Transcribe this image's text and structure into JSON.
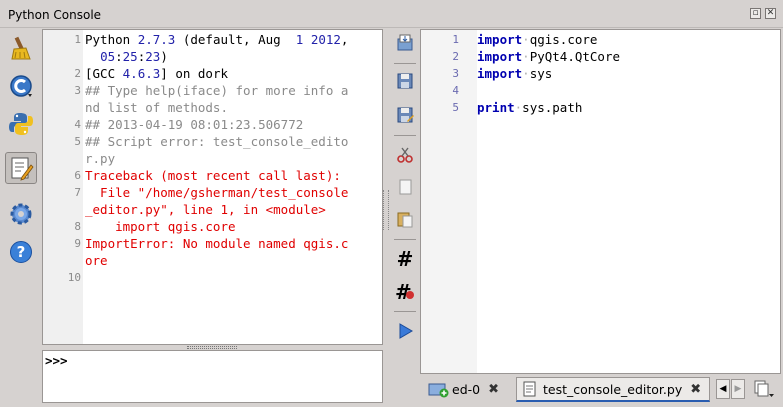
{
  "window": {
    "title": "Python Console",
    "float_symbol": "▫",
    "close_symbol": "✕"
  },
  "console": {
    "lines": [
      {
        "n": "1",
        "parts": [
          {
            "t": "Python ",
            "c": ""
          },
          {
            "t": "2.7.3",
            "c": "blue"
          },
          {
            "t": " (default, Aug  ",
            "c": ""
          },
          {
            "t": "1",
            "c": "blue"
          },
          {
            "t": " ",
            "c": ""
          },
          {
            "t": "2012",
            "c": "blue"
          },
          {
            "t": ",",
            "c": ""
          }
        ]
      },
      {
        "n": "",
        "parts": [
          {
            "t": "  ",
            "c": ""
          },
          {
            "t": "05",
            "c": "blue"
          },
          {
            "t": ":",
            "c": ""
          },
          {
            "t": "25",
            "c": "blue"
          },
          {
            "t": ":",
            "c": ""
          },
          {
            "t": "23",
            "c": "blue"
          },
          {
            "t": ")",
            "c": ""
          }
        ]
      },
      {
        "n": "2",
        "parts": [
          {
            "t": "[GCC ",
            "c": ""
          },
          {
            "t": "4.6.3",
            "c": "blue"
          },
          {
            "t": "] on dork",
            "c": ""
          }
        ]
      },
      {
        "n": "3",
        "parts": [
          {
            "t": "## Type help(iface) for more info a",
            "c": "grey"
          }
        ]
      },
      {
        "n": "",
        "parts": [
          {
            "t": "nd list of methods.",
            "c": "grey"
          }
        ]
      },
      {
        "n": "4",
        "parts": [
          {
            "t": "## 2013-04-19 08:01:23.506772",
            "c": "grey"
          }
        ]
      },
      {
        "n": "5",
        "parts": [
          {
            "t": "## Script error: test_console_edito",
            "c": "grey"
          }
        ]
      },
      {
        "n": "",
        "parts": [
          {
            "t": "r.py",
            "c": "grey"
          }
        ]
      },
      {
        "n": "6",
        "parts": [
          {
            "t": "Traceback (most recent call last):",
            "c": "red"
          }
        ]
      },
      {
        "n": "7",
        "parts": [
          {
            "t": "  File \"/home/gsherman/test_console",
            "c": "red"
          }
        ]
      },
      {
        "n": "",
        "parts": [
          {
            "t": "_editor.py\", line 1, in <module>",
            "c": "red"
          }
        ]
      },
      {
        "n": "8",
        "parts": [
          {
            "t": "    import qgis.core",
            "c": "red"
          }
        ]
      },
      {
        "n": "9",
        "parts": [
          {
            "t": "ImportError: No module named qgis.c",
            "c": "red"
          }
        ]
      },
      {
        "n": "",
        "parts": [
          {
            "t": "ore",
            "c": "red"
          }
        ]
      },
      {
        "n": "10",
        "parts": []
      }
    ],
    "prompt": ">>>"
  },
  "editor": {
    "lines": [
      {
        "n": "1",
        "parts": [
          {
            "t": "import",
            "c": "kw"
          },
          {
            "t": "·",
            "c": "ws"
          },
          {
            "t": "qgis.core",
            "c": ""
          }
        ]
      },
      {
        "n": "2",
        "parts": [
          {
            "t": "import",
            "c": "kw"
          },
          {
            "t": "·",
            "c": "ws"
          },
          {
            "t": "PyQt4.QtCore",
            "c": ""
          }
        ]
      },
      {
        "n": "3",
        "parts": [
          {
            "t": "import",
            "c": "kw"
          },
          {
            "t": "·",
            "c": "ws"
          },
          {
            "t": "sys",
            "c": ""
          }
        ]
      },
      {
        "n": "4",
        "parts": []
      },
      {
        "n": "5",
        "parts": [
          {
            "t": "print",
            "c": "kw"
          },
          {
            "t": "·",
            "c": "ws"
          },
          {
            "t": "sys.path",
            "c": ""
          }
        ]
      }
    ]
  },
  "tabs": [
    {
      "label": "ed-0",
      "active": false
    },
    {
      "label": "test_console_editor.py",
      "active": true
    }
  ],
  "tab_close_symbol": "✖",
  "tab_nav": {
    "prev": "◀",
    "next": "▶"
  },
  "icons": {
    "hash": "#"
  }
}
